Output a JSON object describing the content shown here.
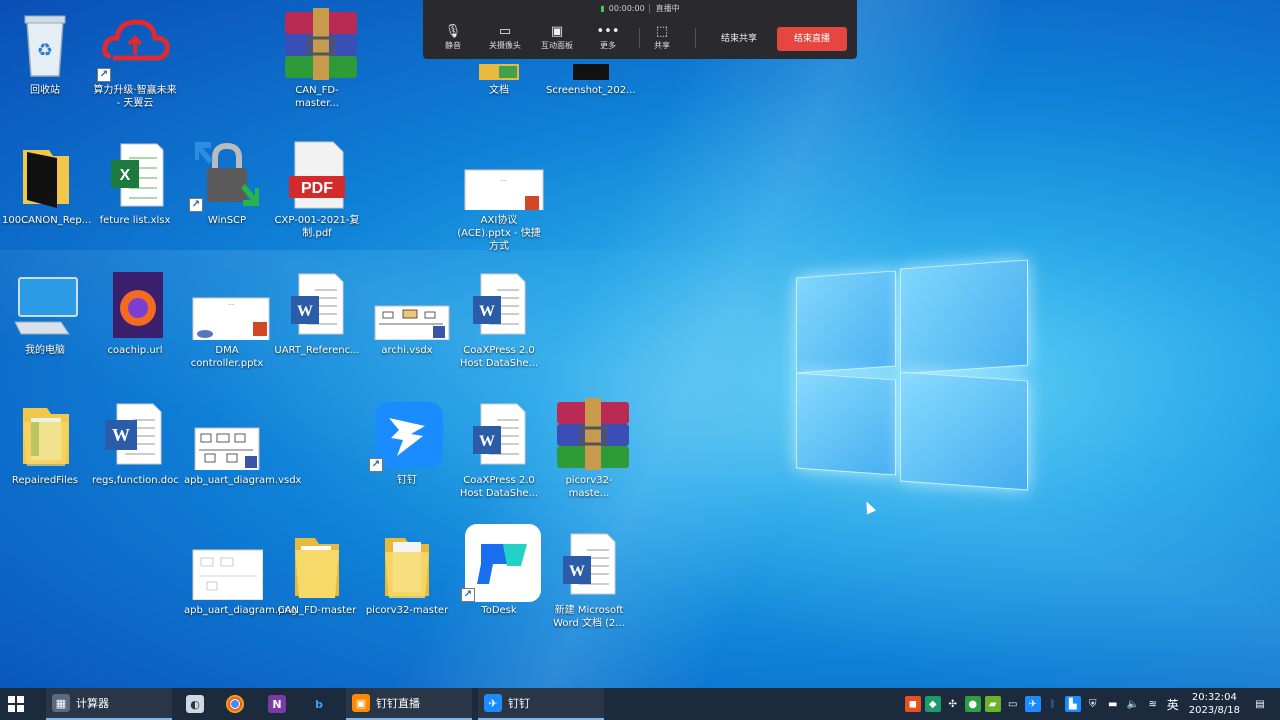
{
  "meeting_toolbar": {
    "timer": "00:00:00",
    "status": "直播中",
    "buttons": {
      "mute": "静音",
      "camera": "关摄像头",
      "whiteboard": "互动面板",
      "more": "更多",
      "share": "共享"
    },
    "end_share": "结束共享",
    "end_live": "结束直播"
  },
  "desktop_icons": {
    "recycle": "回收站",
    "tianyi": "算力升级·智赢未来 - 天翼云",
    "canfd_zip": "CAN_FD-master...",
    "docs": "文档",
    "screenshot": "Screenshot_202...",
    "canon": "100CANON_Rep...",
    "feture": "feture list.xlsx",
    "winscp": "WinSCP",
    "cxp_pdf": "CXP-001-2021-复制.pdf",
    "axi_pptx": "AXI协议(ACE).pptx - 快捷方式",
    "mypc": "我的电脑",
    "coachip": "coachip.url",
    "dma": "DMA controller.pptx",
    "uart_ref": "UART_Referenc...",
    "archi": "archi.vsdx",
    "coax1": "CoaXPress 2.0 Host DataShe...",
    "repaired": "RepairedFiles",
    "regs": "regs,function.doc",
    "apb_vsdx": "apb_uart_diagram.vsdx",
    "dingding": "钉钉",
    "coax2": "CoaXPress 2.0 Host DataShe...",
    "picorv_zip": "picorv32-maste...",
    "apb_png": "apb_uart_diagram.png",
    "canfd_folder": "CAN_FD-master",
    "picorv_folder": "picorv32-master",
    "todesk": "ToDesk",
    "new_word": "新建 Microsoft Word 文档 (2..."
  },
  "taskbar": {
    "calculator": "计算器",
    "dingding_live": "钉钉直播",
    "dingding": "钉钉",
    "ime": "英",
    "time": "20:32:04",
    "date": "2023/8/18"
  },
  "colors": {
    "toolbar_bg": "#2a2a2e",
    "end_live_red": "#e5463f",
    "taskbar_bg": "#1b2a3d"
  }
}
